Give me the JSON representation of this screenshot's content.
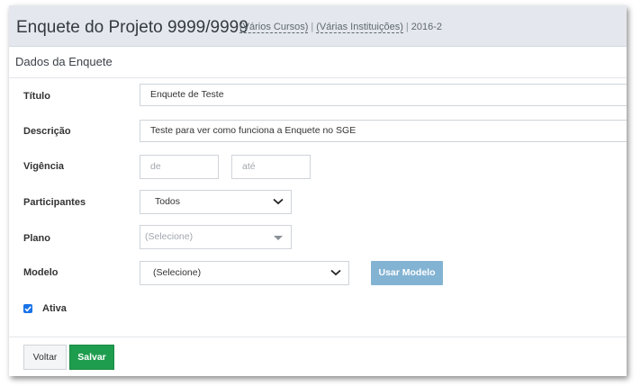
{
  "header": {
    "title": "Enquete do Projeto 9999/9999",
    "cursos_link": "(Vários Cursos)",
    "instituicoes_link": "(Várias Instituições)",
    "separator": "|",
    "period": "2016-2"
  },
  "panel": {
    "title": "Dados da Enquete"
  },
  "form": {
    "titulo": {
      "label": "Título",
      "value": "Enquete de Teste"
    },
    "descricao": {
      "label": "Descrição",
      "value": "Teste para ver como funciona a Enquete no SGE"
    },
    "vigencia": {
      "label": "Vigência",
      "start_placeholder": "de",
      "end_placeholder": "até"
    },
    "participantes": {
      "label": "Participantes",
      "selected": "Todos"
    },
    "plano": {
      "label": "Plano",
      "selected": "(Selecione)"
    },
    "modelo": {
      "label": "Modelo",
      "selected": "(Selecione)",
      "button": "Usar Modelo"
    },
    "ativa": {
      "label": "Ativa",
      "checked": true
    }
  },
  "footer": {
    "back_label": "Voltar",
    "save_label": "Salvar"
  },
  "colors": {
    "header_bg": "#e4e8ee",
    "primary_button": "#83b3d3",
    "save_button": "#1f9d4e",
    "checkbox": "#1a73e8"
  }
}
